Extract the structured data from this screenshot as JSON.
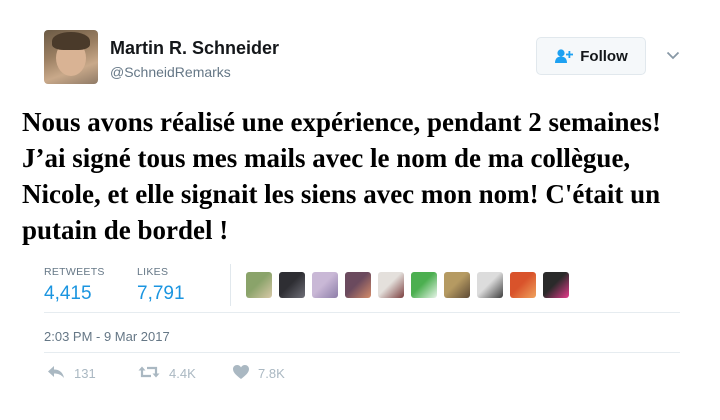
{
  "header": {
    "display_name": "Martin R. Schneider",
    "handle": "@SchneidRemarks",
    "follow_label": "Follow"
  },
  "tweet": {
    "text": "Nous avons réalisé une expérience, pendant 2 semaines! J’ai signé tous mes mails avec le nom de ma collègue, Nicole, et elle signait les siens avec mon nom! C'était un putain de bordel !"
  },
  "stats": {
    "retweets_label": "RETWEETS",
    "retweets_value": "4,415",
    "likes_label": "LIKES",
    "likes_value": "7,791"
  },
  "liker_avatars": [
    {
      "icon": "liker-avatar-1",
      "colors": [
        "#8aa36a",
        "#d8c9a8"
      ]
    },
    {
      "icon": "liker-avatar-2",
      "colors": [
        "#2e2e33",
        "#6f6f78"
      ]
    },
    {
      "icon": "liker-avatar-3",
      "colors": [
        "#c9b8d6",
        "#8d7da8"
      ]
    },
    {
      "icon": "liker-avatar-4",
      "colors": [
        "#6b4a5e",
        "#d58c6a"
      ]
    },
    {
      "icon": "liker-avatar-5",
      "colors": [
        "#e4e0dc",
        "#7a3d3d"
      ]
    },
    {
      "icon": "liker-avatar-6",
      "colors": [
        "#4caf50",
        "#e8f5e9"
      ]
    },
    {
      "icon": "liker-avatar-7",
      "colors": [
        "#b59a62",
        "#5d4a35"
      ]
    },
    {
      "icon": "liker-avatar-8",
      "colors": [
        "#dcdcdc",
        "#3d3d3d"
      ]
    },
    {
      "icon": "liker-avatar-9",
      "colors": [
        "#d9532b",
        "#f0a35e"
      ]
    },
    {
      "icon": "liker-avatar-10",
      "colors": [
        "#2a2a2a",
        "#e63b8c"
      ]
    }
  ],
  "timestamp": "2:03 PM - 9 Mar 2017",
  "actions": {
    "reply_count": "131",
    "retweet_count": "4.4K",
    "like_count": "7.8K"
  },
  "colors": {
    "accent": "#1b95e0",
    "muted": "#657786",
    "action_gray": "#aab8c2"
  }
}
